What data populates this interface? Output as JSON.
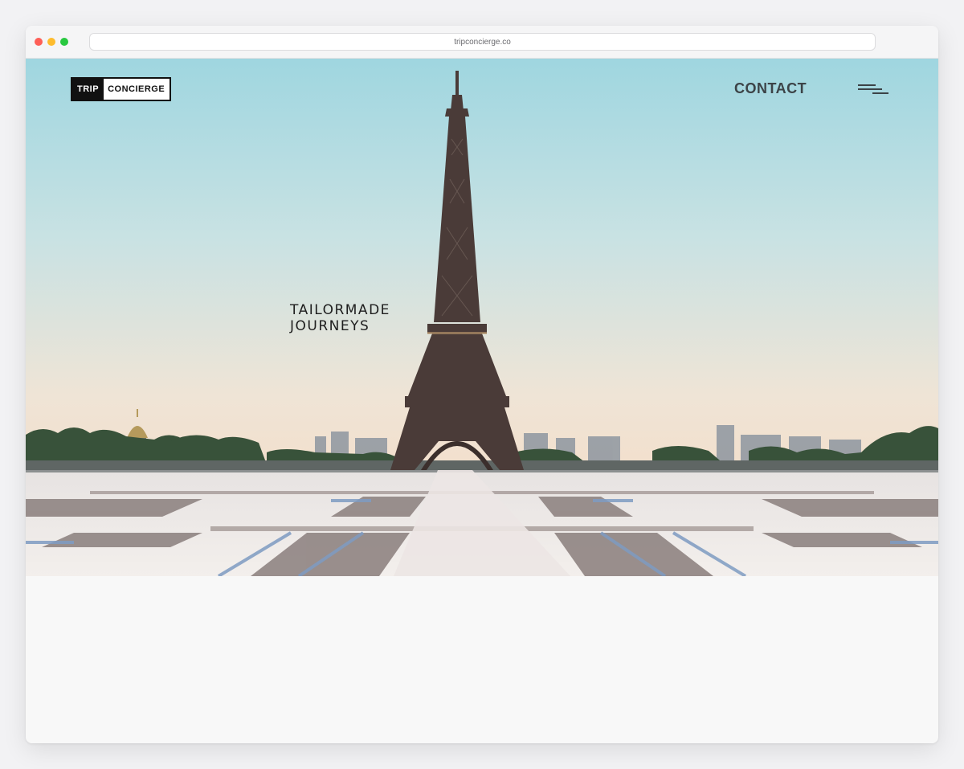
{
  "browser": {
    "url": "tripconcierge.co"
  },
  "header": {
    "logo_part1": "TRIP",
    "logo_part2": "CONCIERGE",
    "contact_label": "CONTACT",
    "menu_icon": "hamburger-menu-icon"
  },
  "hero": {
    "tagline_line1": "TAILORMADE",
    "tagline_line2": "JOURNEYS",
    "image_subject": "Eiffel Tower viewed from Trocadéro plaza"
  },
  "colors": {
    "sky_top": "#9fd4dd",
    "sky_bottom": "#f6dcc4",
    "tower": "#4a3a36",
    "nav_text": "#3c4347"
  }
}
